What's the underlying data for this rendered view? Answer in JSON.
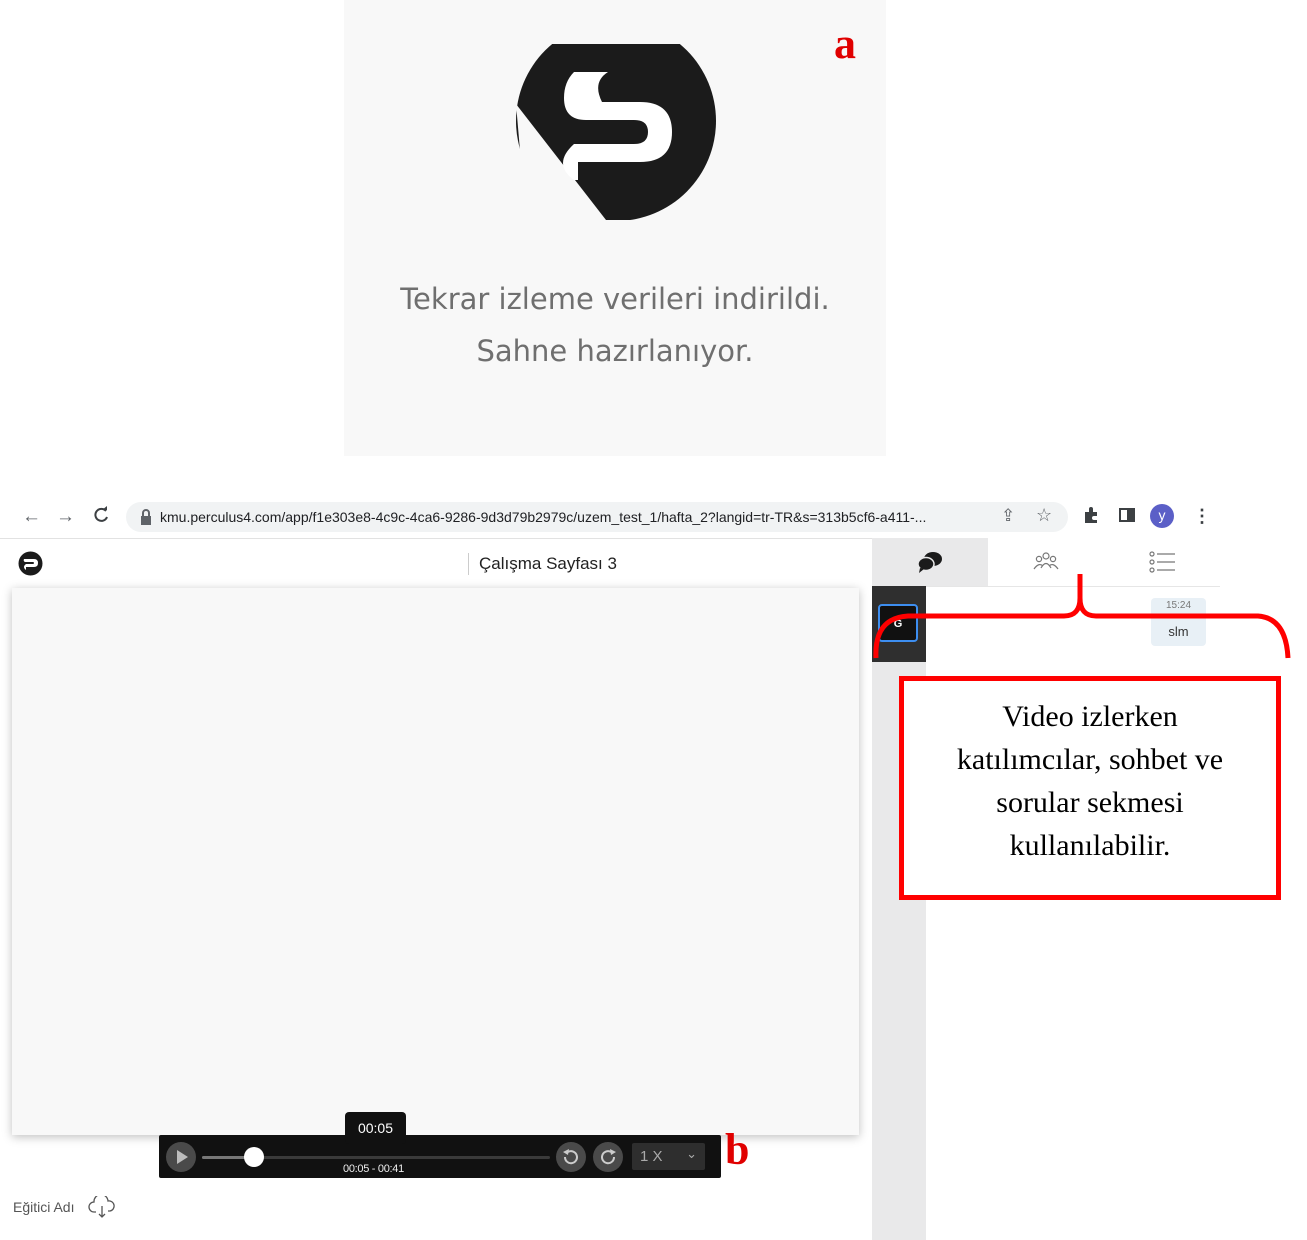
{
  "labels": {
    "a": "a",
    "b": "b"
  },
  "loading": {
    "line1": "Tekrar izleme verileri indirildi.",
    "line2": "Sahne hazırlanıyor."
  },
  "browser": {
    "url": "kmu.perculus4.com/app/f1e303e8-4c9c-4ca6-9286-9d3d79b2979c/uzem_test_1/hafta_2?langid=tr-TR&s=313b5cf6-a411-...",
    "profile_initial": "y"
  },
  "app": {
    "page_title": "Çalışma Sayfası 3",
    "trainer_label": "Eğitici Adı"
  },
  "player": {
    "tooltip": "00:05",
    "time_range": "00:05 - 00:41",
    "speed": "1 X",
    "progress": 0.14
  },
  "sidebar": {
    "tabs": [
      "chat",
      "participants",
      "questions"
    ],
    "active_tab": "chat",
    "avatar_initial": "G",
    "message": {
      "time": "15:24",
      "text": "slm"
    }
  },
  "annotation": {
    "text_lines": [
      "Video izlerken",
      "katılımcılar, sohbet ve",
      "sorular sekmesi",
      "kullanılabilir."
    ]
  },
  "colors": {
    "annotation": "#ff0000",
    "avatar": "#5b5fc7",
    "active_border": "#3d8ef0"
  }
}
